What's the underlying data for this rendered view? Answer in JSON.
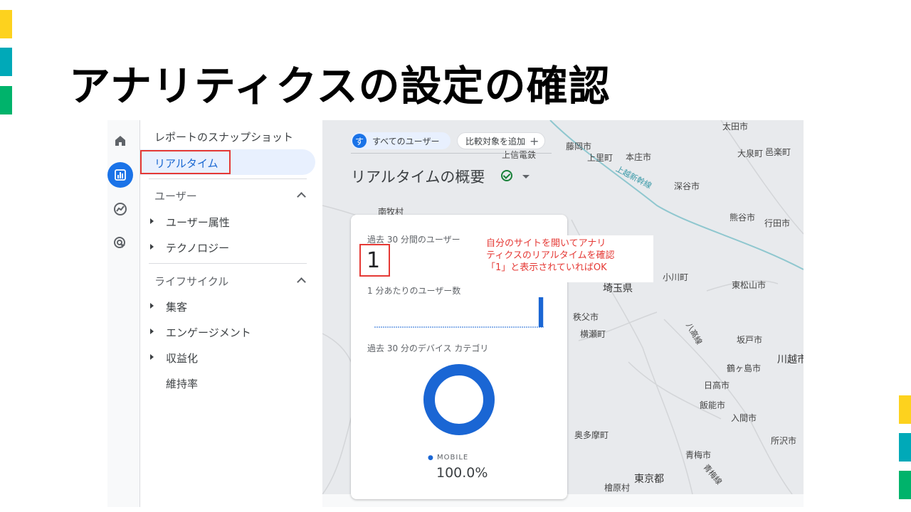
{
  "slide": {
    "title": "アナリティクスの設定の確認",
    "accent_colors": [
      "#fdd21e",
      "#00a9b8",
      "#00b36b"
    ]
  },
  "rail": {
    "icons": [
      "home-icon",
      "reports-icon",
      "explore-icon",
      "advertising-icon"
    ]
  },
  "nav": {
    "snapshot": "レポートのスナップショット",
    "realtime": "リアルタイム",
    "user_section": "ユーザー",
    "user_attributes": "ユーザー属性",
    "technology": "テクノロジー",
    "lifecycle_section": "ライフサイクル",
    "acquisition": "集客",
    "engagement": "エンゲージメント",
    "monetization": "収益化",
    "retention": "維持率"
  },
  "header": {
    "audience_chip_avatar": "す",
    "audience_chip": "すべてのユーザー",
    "compare_chip": "比較対象を追加",
    "compare_plus": "+",
    "page_title": "リアルタイムの概要"
  },
  "card": {
    "users_label": "過去 30 分間のユーザー",
    "users_value": "1",
    "per_minute_label": "1 分あたりのユーザー数",
    "device_label": "過去 30 分のデバイス カテゴリ",
    "legend_label": "MOBILE",
    "legend_value": "100.0%"
  },
  "annotation": {
    "line1": "自分のサイトを開いてアナリ",
    "line2": "ティクスのリアルタイムを確認",
    "line3": "「1」と表示されていればOK"
  },
  "map": {
    "labels": [
      "太田市",
      "大泉町",
      "邑楽町",
      "藤岡市",
      "上里町",
      "本庄市",
      "上信電鉄",
      "上越新幹線",
      "深谷市",
      "南牧村",
      "熊谷市",
      "行田市",
      "小川町",
      "東松山市",
      "埼玉県",
      "秩父市",
      "横瀬町",
      "八高線",
      "坂戸市",
      "川越市",
      "鶴ヶ島市",
      "日高市",
      "飯能市",
      "入間市",
      "奥多摩町",
      "所沢市",
      "青梅市",
      "青梅線",
      "東京都",
      "檜原村"
    ]
  },
  "chart_data": [
    {
      "type": "bar",
      "title": "1 分あたりのユーザー数",
      "values": [
        0,
        0,
        0,
        0,
        0,
        0,
        0,
        0,
        0,
        0,
        0,
        0,
        0,
        0,
        0,
        0,
        0,
        0,
        0,
        0,
        0,
        0,
        0,
        0,
        0,
        0,
        0,
        0,
        0,
        1
      ],
      "ylim": [
        0,
        1
      ]
    },
    {
      "type": "pie",
      "title": "過去 30 分のデバイス カテゴリ",
      "categories": [
        "MOBILE"
      ],
      "values": [
        100.0
      ],
      "colors": [
        "#1a66d4"
      ]
    }
  ]
}
